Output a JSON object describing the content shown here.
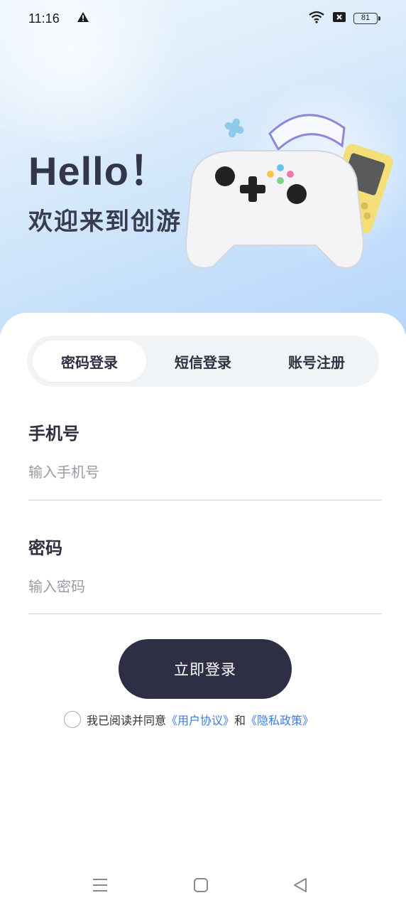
{
  "status_bar": {
    "time": "11:16",
    "battery": "81",
    "icons": [
      "warning-icon",
      "wifi-icon",
      "sim-off-icon",
      "battery-icon"
    ]
  },
  "hero": {
    "hello": "Hello！",
    "welcome": "欢迎来到创游"
  },
  "tabs": [
    {
      "label": "密码登录",
      "active": true
    },
    {
      "label": "短信登录",
      "active": false
    },
    {
      "label": "账号注册",
      "active": false
    }
  ],
  "form": {
    "phone_label": "手机号",
    "phone_placeholder": "输入手机号",
    "password_label": "密码",
    "password_placeholder": "输入密码"
  },
  "login_button": "立即登录",
  "agreement": {
    "prefix": "我已阅读并同意",
    "user_agreement": "《用户协议》",
    "conjunction": "和",
    "privacy_policy": "《隐私政策》"
  },
  "nav": {
    "icons": [
      "menu-icon",
      "home-square-icon",
      "back-triangle-icon"
    ]
  },
  "colors": {
    "primary_button": "#2e2f45",
    "link": "#3d7be0",
    "hero_gradient_end": "#b6d6fa"
  }
}
